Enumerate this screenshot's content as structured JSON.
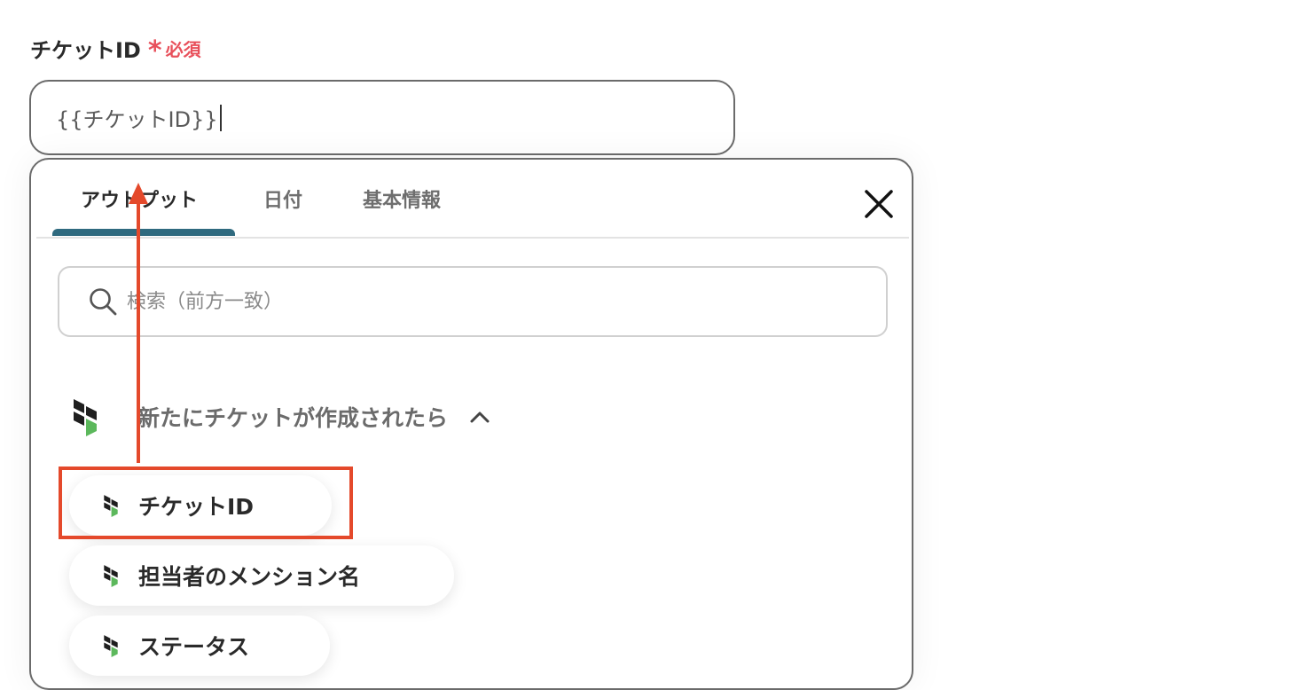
{
  "field": {
    "label": "チケットID",
    "required_mark": "*",
    "required_text": "必須",
    "value": "{{チケットID}}"
  },
  "popup": {
    "tabs": [
      {
        "label": "アウトプット",
        "active": true
      },
      {
        "label": "日付",
        "active": false
      },
      {
        "label": "基本情報",
        "active": false
      }
    ],
    "close_icon": "close-icon",
    "search": {
      "icon": "search-icon",
      "placeholder": "検索（前方一致）",
      "value": ""
    },
    "trigger": {
      "icon": "app-logo-icon",
      "title": "新たにチケットが作成されたら",
      "expanded": true,
      "chevron_icon": "chevron-up-icon"
    },
    "outputs": [
      {
        "label": "チケットID",
        "highlighted": true
      },
      {
        "label": "担当者のメンション名",
        "highlighted": false
      },
      {
        "label": "ステータス",
        "highlighted": false
      }
    ]
  },
  "colors": {
    "accent_tab": "#2f6a7f",
    "required": "#e8505b",
    "annotation": "#e4492b",
    "logo_dark": "#1f1f1f",
    "logo_green": "#5cb85c"
  }
}
